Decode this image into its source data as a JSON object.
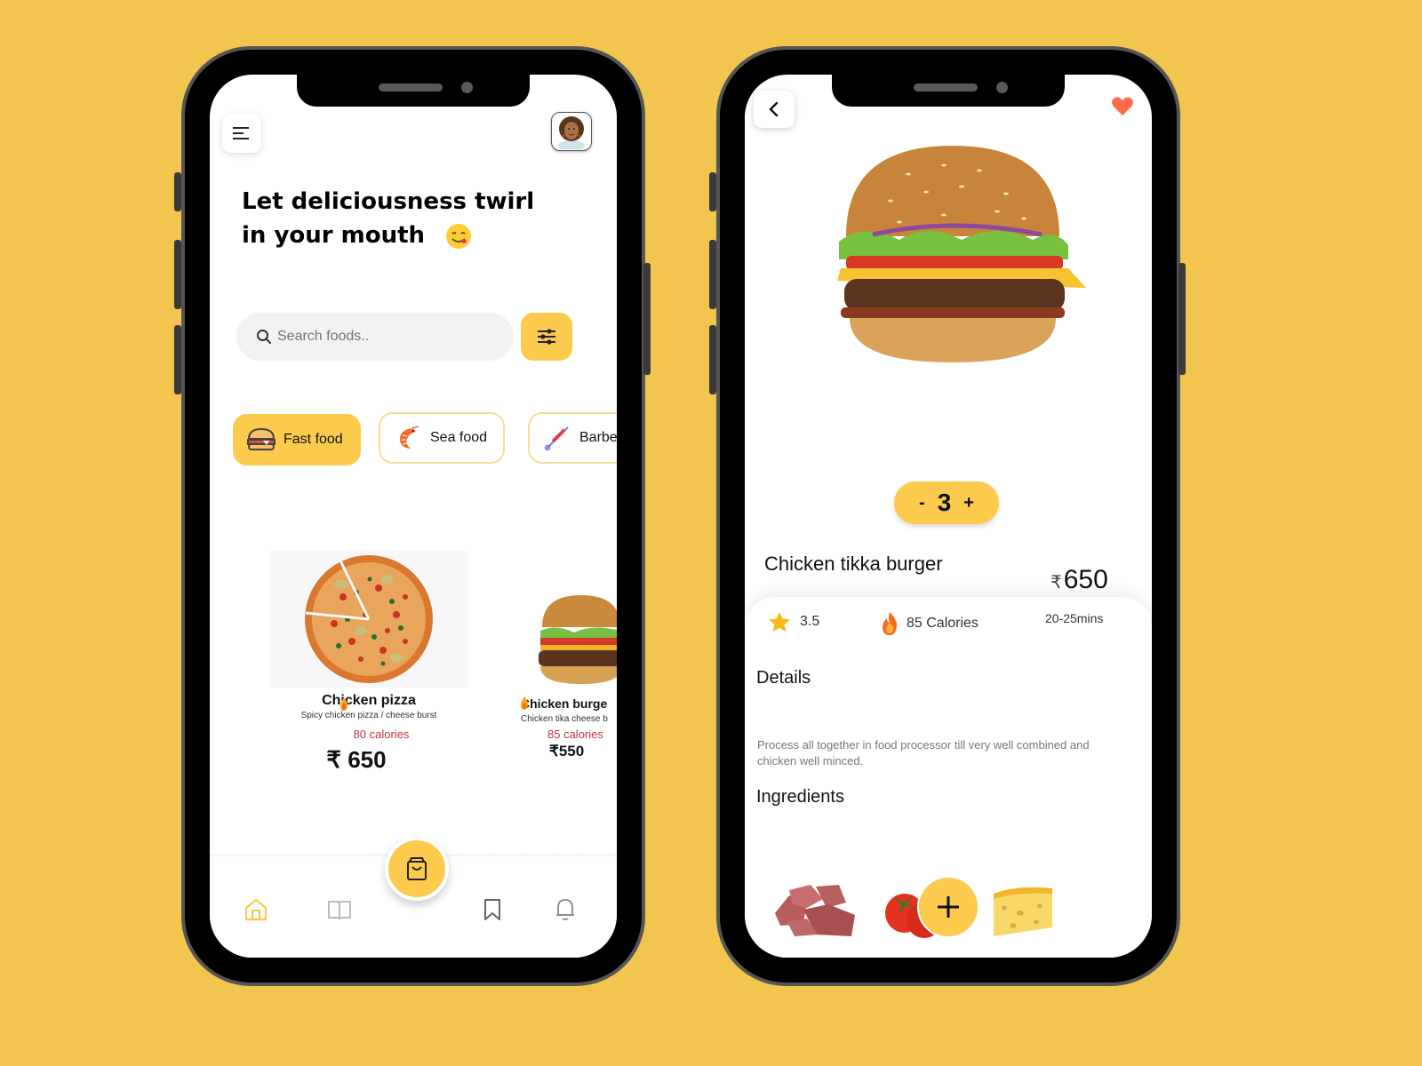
{
  "home": {
    "headline": "Let deliciousness twirl in your mouth",
    "headline_emoji": "😋",
    "search": {
      "placeholder": "Search foods..",
      "value": ""
    },
    "categories": [
      {
        "label": "Fast food",
        "icon": "burger-icon",
        "active": true
      },
      {
        "label": "Sea food",
        "icon": "shrimp-icon",
        "active": false
      },
      {
        "label": "Barbe",
        "icon": "skewer-icon",
        "active": false
      }
    ],
    "foods": [
      {
        "name": "Chicken pizza",
        "description": "Spicy chicken pizza / cheese burst",
        "calories": "80 calories",
        "price": "₹  650"
      },
      {
        "name": "Chicken burge",
        "description": "Chicken tika cheese b",
        "calories": "85 calories",
        "price": "₹550"
      }
    ],
    "nav": [
      {
        "name": "home",
        "icon": "home-icon",
        "active": true
      },
      {
        "name": "menu",
        "icon": "book-icon",
        "active": false
      },
      {
        "name": "cart",
        "icon": "shopping-bag-icon",
        "active": false
      },
      {
        "name": "saved",
        "icon": "bookmark-icon",
        "active": false
      },
      {
        "name": "notifications",
        "icon": "bell-icon",
        "active": false
      }
    ]
  },
  "detail": {
    "title": "Chicken tikka burger",
    "currency": "₹",
    "price": "650",
    "quantity": {
      "minus": "-",
      "value": "3",
      "plus": "+"
    },
    "rating": "3.5",
    "calories": "85 Calories",
    "time": "20-25mins",
    "details_heading": "Details",
    "details_text": "Process all together in food processor till very well combined and chicken well minced.",
    "ingredients_heading": "Ingredients",
    "ingredients": [
      "Meat",
      "Tomato",
      "Cheese"
    ],
    "favorite": true
  },
  "colors": {
    "background": "#F2C54F",
    "accent": "#FCCB4E",
    "calories_red": "#c6343a",
    "heart": "#FF6B4A"
  }
}
